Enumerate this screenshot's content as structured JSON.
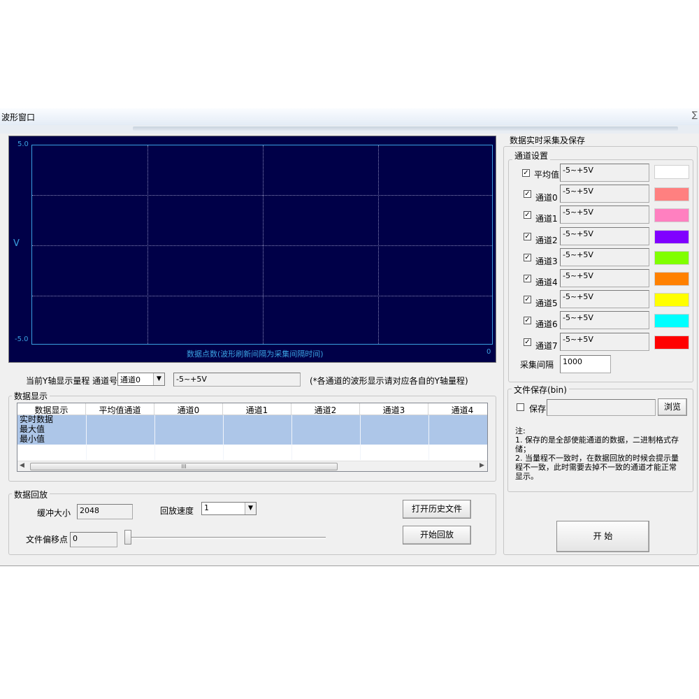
{
  "window": {
    "title": "波形窗口",
    "close_glyph": "∑"
  },
  "plot": {
    "y_max_label": "5.0",
    "y_min_label": "-5.0",
    "y_axis_label": "V",
    "x_axis_label": "数据点数(波形刷新间隔为采集间隔时间)",
    "x_end_label": "0",
    "background": "#000048",
    "axis_color": "#3aa0e0"
  },
  "range_bar": {
    "label": "当前Y轴显示量程 通道号",
    "channel_value": "通道0",
    "range_value": "-5~+5V",
    "note": "(*各通道的波形显示请对应各自的Y轴量程)"
  },
  "data_display": {
    "group_label": "数据显示",
    "columns": [
      "数据显示",
      "平均值通道",
      "通道0",
      "通道1",
      "通道2",
      "通道3",
      "通道4"
    ],
    "rows": [
      "实时数据",
      "最大值",
      "最小值"
    ],
    "scroll_thumb": "III"
  },
  "playback": {
    "group_label": "数据回放",
    "buffer_label": "缓冲大小",
    "buffer_value": "2048",
    "speed_label": "回放速度",
    "speed_value": "1",
    "offset_label": "文件偏移点",
    "offset_value": "0",
    "open_history_button": "打开历史文件",
    "start_playback_button": "开始回放"
  },
  "acquisition": {
    "group_label": "数据实时采集及保存",
    "channel_settings_label": "通道设置",
    "channels": [
      {
        "label": "平均值",
        "range": "-5~+5V",
        "color": "#ffffff",
        "checked": "✓"
      },
      {
        "label": "通道0",
        "range": "-5~+5V",
        "color": "#ff8080",
        "checked": "✓"
      },
      {
        "label": "通道1",
        "range": "-5~+5V",
        "color": "#ff80c0",
        "checked": "✓"
      },
      {
        "label": "通道2",
        "range": "-5~+5V",
        "color": "#8000ff",
        "checked": "✓"
      },
      {
        "label": "通道3",
        "range": "-5~+5V",
        "color": "#80ff00",
        "checked": "✓"
      },
      {
        "label": "通道4",
        "range": "-5~+5V",
        "color": "#ff8000",
        "checked": "✓"
      },
      {
        "label": "通道5",
        "range": "-5~+5V",
        "color": "#ffff00",
        "checked": "✓"
      },
      {
        "label": "通道6",
        "range": "-5~+5V",
        "color": "#00ffff",
        "checked": "✓"
      },
      {
        "label": "通道7",
        "range": "-5~+5V",
        "color": "#ff0000",
        "checked": "✓"
      }
    ],
    "interval_label": "采集间隔",
    "interval_value": "1000"
  },
  "file_save": {
    "group_label": "文件保存(bin)",
    "save_label": "保存",
    "path_value": "",
    "browse_button": "浏览",
    "note_title": "注:",
    "note_1": "1. 保存的是全部使能通道的数据，二进制格式存储；",
    "note_2": "2. 当量程不一致时，在数据回放的时候会提示量程不一致，此时需要去掉不一致的通道才能正常显示。"
  },
  "start_button": "开 始"
}
